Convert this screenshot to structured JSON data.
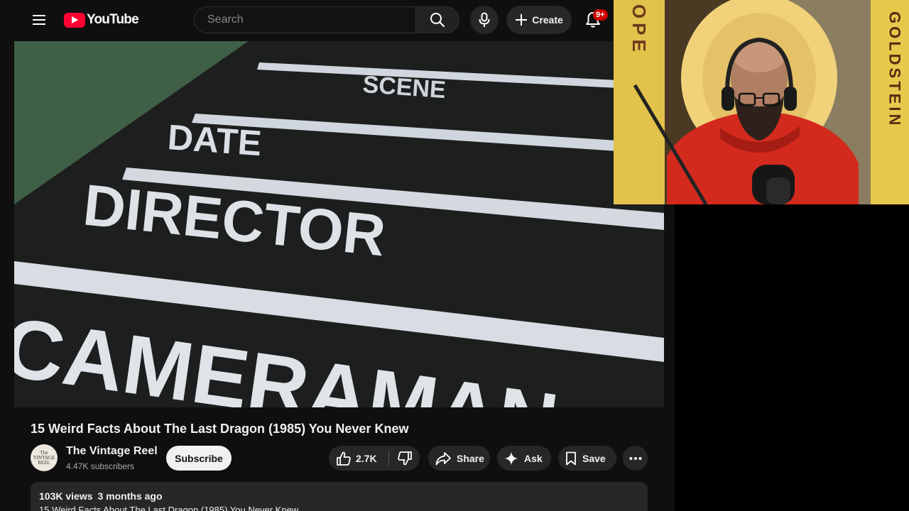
{
  "header": {
    "logo_text": "YouTube",
    "search_placeholder": "Search",
    "create_label": "Create",
    "notification_badge": "9+"
  },
  "video_frame": {
    "slate_labels": [
      "SCENE",
      "DATE",
      "DIRECTOR",
      "CAMERAMAN"
    ]
  },
  "video": {
    "title": "15 Weird Facts About The Last Dragon (1985) You Never Knew",
    "channel": {
      "avatar_text": [
        "The",
        "VINTAGE",
        "REEL"
      ],
      "name": "The Vintage Reel",
      "subscribers": "4.47K subscribers"
    },
    "subscribe_label": "Subscribe",
    "likes": "2.7K",
    "share_label": "Share",
    "ask_label": "Ask",
    "save_label": "Save",
    "description": {
      "views": "103K views",
      "age": "3 months ago",
      "text": "15 Weird Facts About The Last Dragon (1985) You Never Knew"
    }
  },
  "webcam": {
    "banner_left": "HOPE",
    "banner_right": "GOLDSTEIN"
  },
  "colors": {
    "background": "#0f0f0f",
    "brand_red": "#ff0033",
    "pill": "#272727",
    "badge": "#cc0000",
    "webcam_shirt": "#d42a1e",
    "webcam_banner": "#e8c84a"
  }
}
